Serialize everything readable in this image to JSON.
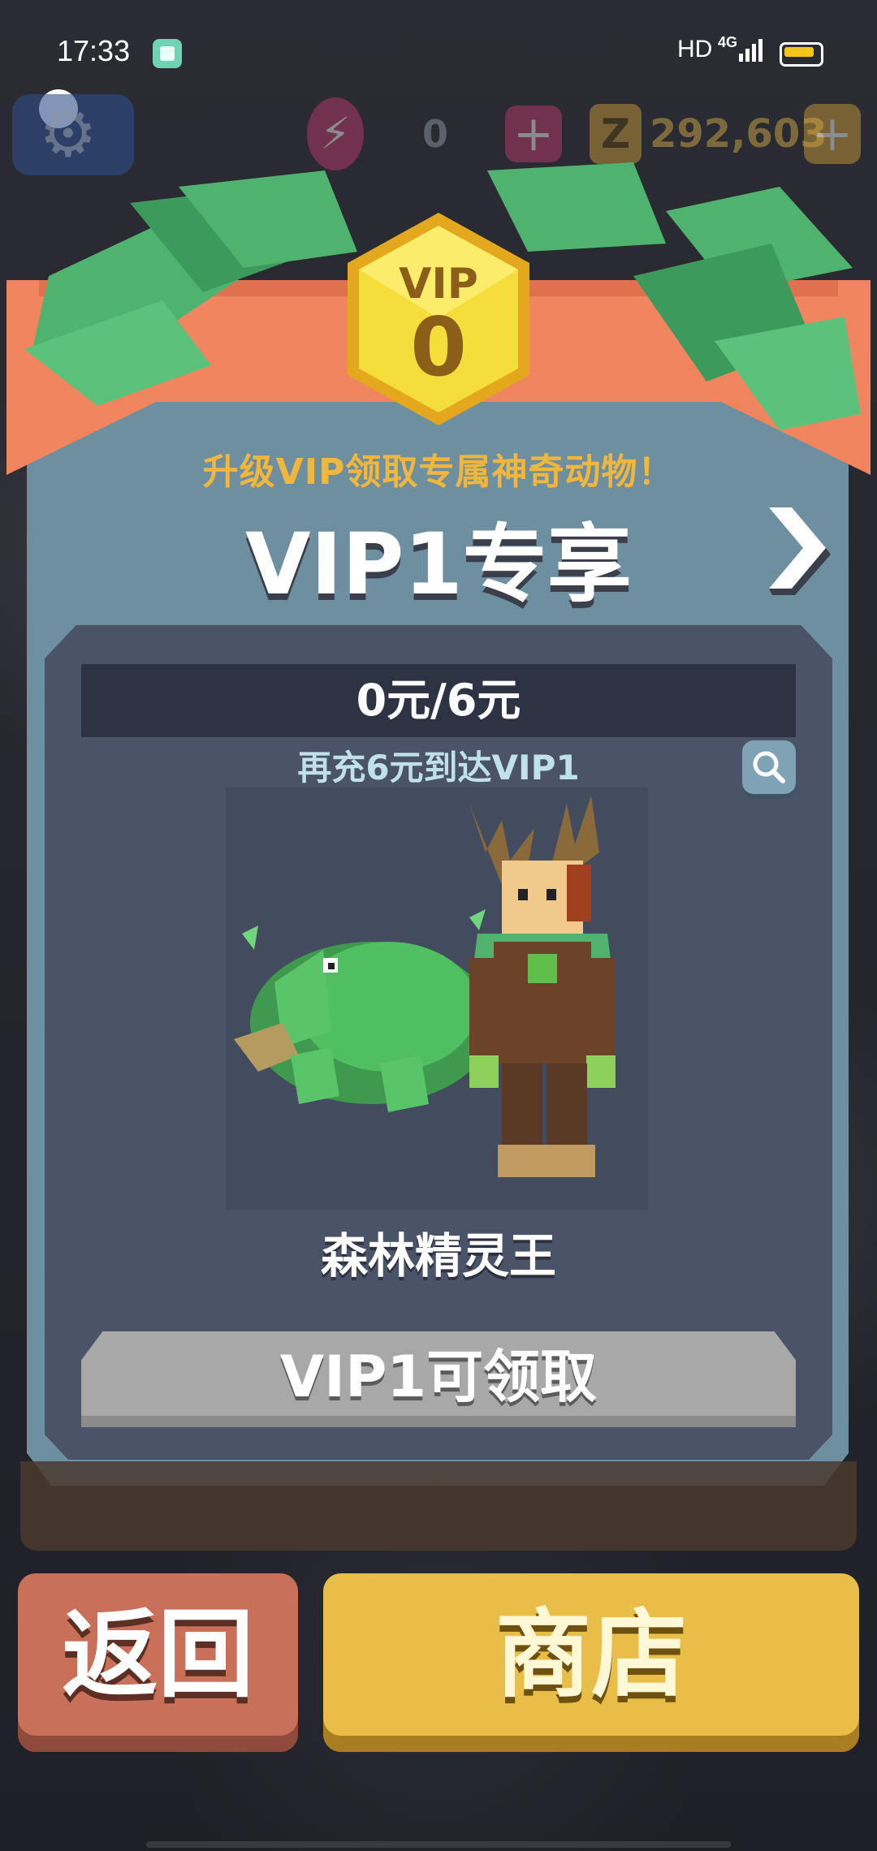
{
  "status_bar": {
    "time": "17:33",
    "network_type": "HD",
    "signal": "4G"
  },
  "hud": {
    "energy_value": "0",
    "coin_value": "292,603",
    "energy_plus": "+",
    "coin_plus": "+",
    "coin_symbol": "Z"
  },
  "vip_badge": {
    "label": "VIP",
    "level": "0"
  },
  "vip_panel": {
    "subtitle": "升级VIP领取专属神奇动物！",
    "title": "VIP1专享",
    "progress_text": "0元/6元",
    "recharge_hint": "再充6元到达VIP1",
    "reward_name": "森林精灵王",
    "claim_button": "VIP1可领取"
  },
  "bottom": {
    "back_label": "返回",
    "shop_label": "商店"
  },
  "colors": {
    "banner": "#f08560",
    "leaf": "#4fb36f",
    "panel": "#6e8fa0",
    "gold": "#f1b73d",
    "shop": "#e8bd48",
    "back": "#c8705a"
  }
}
